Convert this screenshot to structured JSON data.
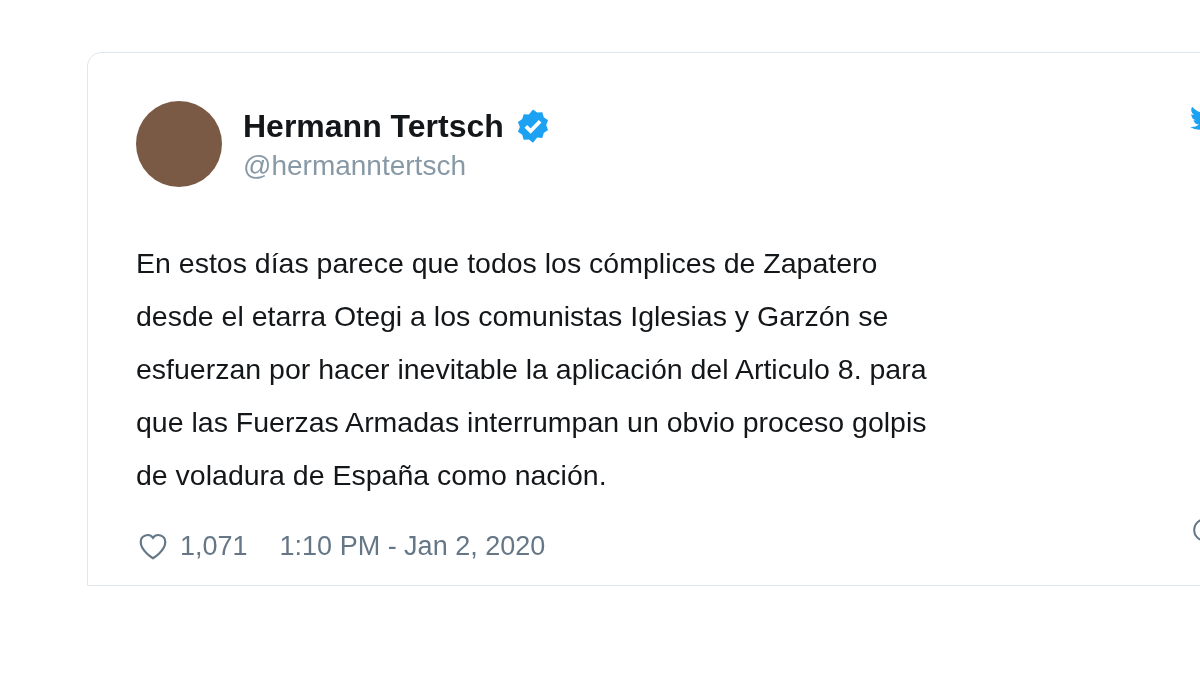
{
  "tweet": {
    "author": {
      "name": "Hermann Tertsch",
      "verified": true,
      "handle": "@hermanntertsch"
    },
    "text_lines": [
      "En estos días parece que todos los cómplices de Zapatero",
      "desde el etarra Otegi a los comunistas Iglesias y Garzón se",
      "esfuerzan por hacer inevitable la aplicación del Articulo 8. para",
      "que las Fuerzas Armadas interrumpan un obvio proceso golpis",
      "de voladura de España como nación."
    ],
    "likes": "1,071",
    "timestamp": "1:10 PM - Jan 2, 2020"
  }
}
